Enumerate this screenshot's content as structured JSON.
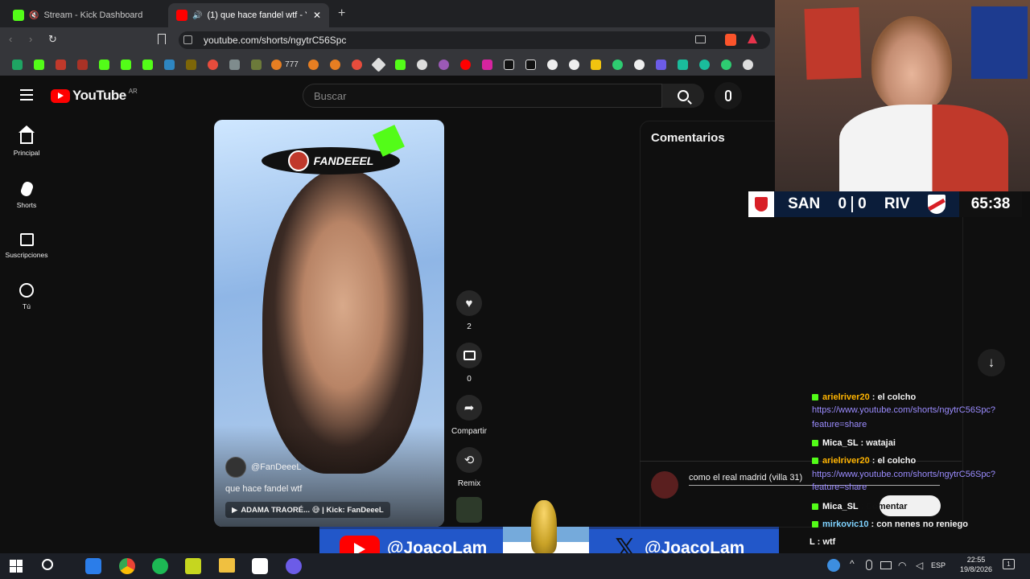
{
  "browser": {
    "tabs": [
      {
        "label": "Stream - Kick Dashboard",
        "active": false
      },
      {
        "label": "(1) que hace fandel wtf - YouTube",
        "active": true
      }
    ],
    "url": "youtube.com/shorts/ngytrC56Spc",
    "bookmark_label": "777"
  },
  "youtube": {
    "logo": "YouTube",
    "region": "AR",
    "search_placeholder": "Buscar",
    "sidebar": [
      {
        "label": "Principal",
        "icon": "home-icon"
      },
      {
        "label": "Shorts",
        "icon": "shorts-icon"
      },
      {
        "label": "Suscripciones",
        "icon": "subscriptions-icon"
      },
      {
        "label": "Tú",
        "icon": "you-icon"
      }
    ],
    "short": {
      "overlay_tag": "FANDEEEL",
      "channel": "@FanDeeeL",
      "title": "que hace fandel wtf",
      "sound": "ADAMA TRAORÉ... 😅 | Kick: FanDeeeL"
    },
    "actions": {
      "likes": "2",
      "comments": "0",
      "share": "Compartir",
      "remix": "Remix"
    },
    "comments_panel": {
      "title": "Comentarios",
      "comment_text": "como el real madrid (villa 31)"
    }
  },
  "scoreboard": {
    "home": "SAN",
    "home_score": "0",
    "away_score": "0",
    "away": "RIV",
    "clock": "65:38"
  },
  "chat": [
    {
      "user": "arielriver20",
      "text": ": el colcho"
    },
    {
      "link1": "https://www.youtube.com/shorts/ngytrC56Spc?",
      "link2": "feature=share"
    },
    {
      "user": "Mica_SL",
      "text": ": watajai"
    },
    {
      "user": "arielriver20",
      "text": ": el colcho"
    },
    {
      "link1": "https://www.youtube.com/shorts/ngytrC56Spc?",
      "link2": "feature=share"
    },
    {
      "user": "Mica_SL",
      "text": ": Comentar"
    },
    {
      "user": "mirkovic10",
      "text": ": con nenes no reniego"
    },
    {
      "user": "L",
      "text": ": wtf"
    }
  ],
  "banner": {
    "youtube_handle": "@JoacoLam_",
    "x_handle": "@JoacoLam"
  },
  "taskbar": {
    "lang": "ESP",
    "time": "22:55",
    "date": "19/8/2026",
    "notifications": "1"
  },
  "colors": {
    "youtube_red": "#ff0000",
    "kick_green": "#53fc18",
    "chat_user": "#ffb400",
    "chat_link": "#9b8cff",
    "banner_blue": "#2257c9"
  }
}
